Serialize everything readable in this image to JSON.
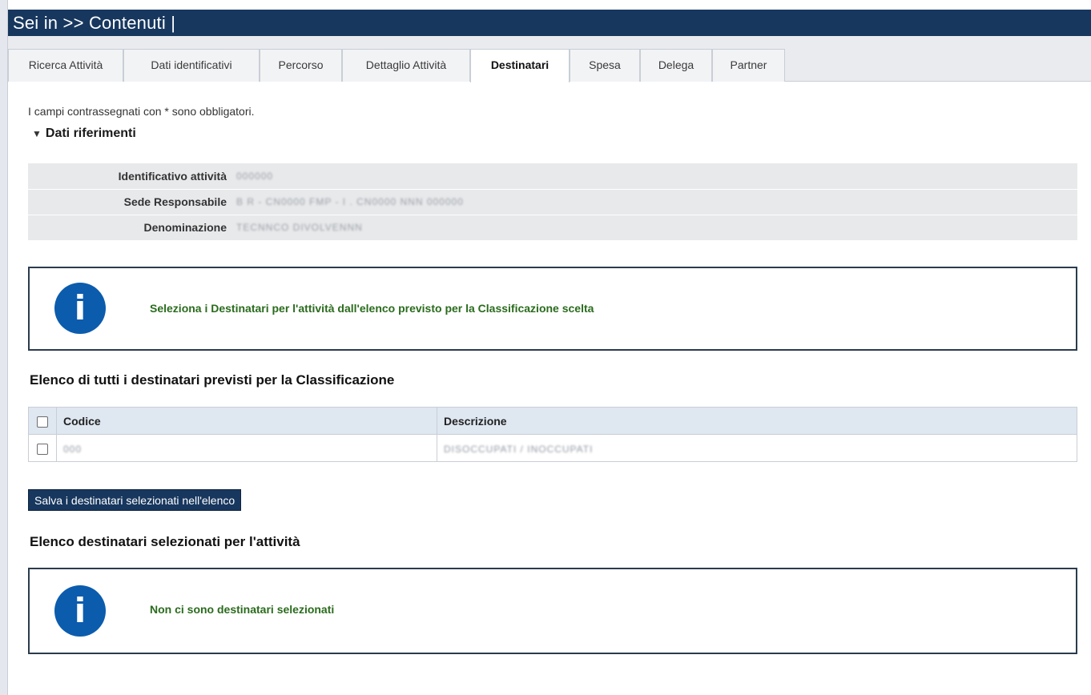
{
  "breadcrumb": "Sei in >> Contenuti |",
  "tabs": [
    {
      "label": "Ricerca Attività"
    },
    {
      "label": "Dati identificativi"
    },
    {
      "label": "Percorso"
    },
    {
      "label": "Dettaglio Attività"
    },
    {
      "label": "Destinatari"
    },
    {
      "label": "Spesa"
    },
    {
      "label": "Delega"
    },
    {
      "label": "Partner"
    }
  ],
  "active_tab": "Destinatari",
  "mandatory_note": "I campi contrassegnati con * sono obbligatori.",
  "section_title": "Dati riferimenti",
  "riferimenti": [
    {
      "label": "Identificativo attività",
      "value": "000000"
    },
    {
      "label": "Sede Responsabile",
      "value": "B R - CN0000 FMP - I . CN0000 NNN 000000"
    },
    {
      "label": "Denominazione",
      "value": "TECNNCO DIVOLVENNN"
    }
  ],
  "info_select": "Seleziona i Destinatari per l'attività dall'elenco previsto per la Classificazione scelta",
  "list_all_title": "Elenco di tutti i destinatari previsti per la Classificazione",
  "table": {
    "headers": {
      "code": "Codice",
      "description": "Descrizione"
    },
    "rows": [
      {
        "code": "000",
        "description": "DISOCCUPATI / INOCCUPATI"
      }
    ]
  },
  "save_button": "Salva i destinatari selezionati nell'elenco",
  "list_selected_title": "Elenco destinatari selezionati per l'attività",
  "info_empty": "Non ci sono destinatari selezionati",
  "colors": {
    "header_bar": "#17375e",
    "info_icon": "#0b5cad",
    "info_text": "#2a6b1d",
    "table_header": "#dfe7f1"
  },
  "icons": {
    "info": "info-icon",
    "section_toggle": "triangle-down-icon"
  }
}
